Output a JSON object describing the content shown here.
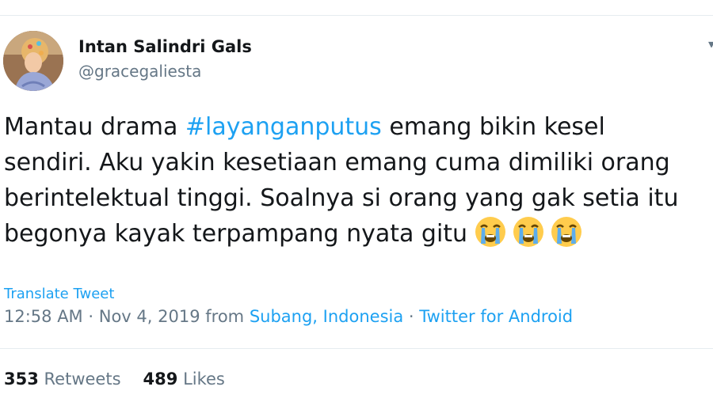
{
  "user": {
    "display_name": "Intan Salindri Gals",
    "handle": "@gracegaliesta"
  },
  "tweet": {
    "lines": [
      {
        "before": "Mantau drama ",
        "hashtag": "#layanganputus",
        "after": " emang bikin kesel"
      },
      {
        "text": "sendiri. Aku yakin kesetiaan emang cuma dimiliki orang"
      },
      {
        "text": "berintelektual tinggi. Soalnya si orang yang gak setia itu"
      },
      {
        "text": "begonya kayak terpampang nyata gitu"
      }
    ],
    "emojis": [
      "loudly-crying-face-emoji",
      "loudly-crying-face-emoji",
      "loudly-crying-face-emoji"
    ]
  },
  "translate_label": "Translate Tweet",
  "meta": {
    "time": "12:58 AM",
    "date": "Nov 4, 2019",
    "from_label": "from",
    "location": "Subang, Indonesia",
    "separator": "·",
    "source": "Twitter for Android"
  },
  "stats": {
    "retweets_count": "353",
    "retweets_label": "Retweets",
    "likes_count": "489",
    "likes_label": "Likes"
  },
  "colors": {
    "link": "#1da1f2",
    "muted": "#657786",
    "text": "#14171a",
    "rule": "#e6ecf0"
  },
  "icons": {
    "menu": "chevron-down-icon"
  }
}
